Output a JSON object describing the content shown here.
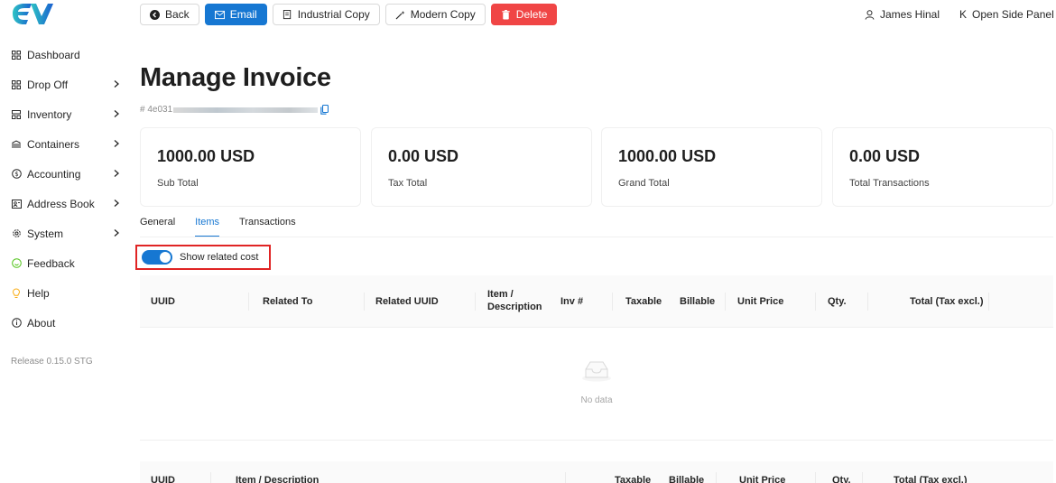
{
  "sidebar": {
    "items": [
      {
        "label": "Dashboard",
        "icon": "grid-icon",
        "has_arrow": false
      },
      {
        "label": "Drop Off",
        "icon": "grid-icon",
        "has_arrow": true
      },
      {
        "label": "Inventory",
        "icon": "grid-icon",
        "has_arrow": true
      },
      {
        "label": "Containers",
        "icon": "container-icon",
        "has_arrow": true
      },
      {
        "label": "Accounting",
        "icon": "dollar-circle-icon",
        "has_arrow": true
      },
      {
        "label": "Address Book",
        "icon": "contacts-icon",
        "has_arrow": true
      },
      {
        "label": "System",
        "icon": "gear-icon",
        "has_arrow": true
      },
      {
        "label": "Feedback",
        "icon": "smile-icon",
        "has_arrow": false
      },
      {
        "label": "Help",
        "icon": "bulb-icon",
        "has_arrow": false
      },
      {
        "label": "About",
        "icon": "info-circle-icon",
        "has_arrow": false
      }
    ],
    "release": "Release 0.15.0 STG"
  },
  "toolbar": {
    "back_label": "Back",
    "email_label": "Email",
    "industrial_label": "Industrial Copy",
    "modern_label": "Modern Copy",
    "delete_label": "Delete"
  },
  "header": {
    "user_name": "James Hinal",
    "side_panel_label": "Open Side Panel",
    "side_panel_glyph": "K"
  },
  "page": {
    "title": "Manage Invoice",
    "invoice_prefix": "# 4e031"
  },
  "stats": [
    {
      "value": "1000.00 USD",
      "label": "Sub Total"
    },
    {
      "value": "0.00 USD",
      "label": "Tax Total"
    },
    {
      "value": "1000.00 USD",
      "label": "Grand Total"
    },
    {
      "value": "0.00 USD",
      "label": "Total Transactions"
    }
  ],
  "tabs": [
    {
      "label": "General",
      "active": false
    },
    {
      "label": "Items",
      "active": true
    },
    {
      "label": "Transactions",
      "active": false
    }
  ],
  "toggle": {
    "label": "Show related cost",
    "on": true
  },
  "items_table": {
    "columns": [
      "UUID",
      "Related To",
      "Related UUID",
      "Item / Description",
      "Inv #",
      "Taxable",
      "Billable",
      "Unit Price",
      "Qty.",
      "Total (Tax excl.)"
    ],
    "empty_text": "No data"
  },
  "second_table": {
    "columns": [
      "UUID",
      "Item / Description",
      "Taxable",
      "Billable",
      "Unit Price",
      "Qty.",
      "Total (Tax excl.)"
    ]
  },
  "colors": {
    "primary": "#1677d2",
    "danger": "#f04545",
    "highlight": "#e02424",
    "feedback": "#52c41a",
    "help": "#faad14"
  }
}
